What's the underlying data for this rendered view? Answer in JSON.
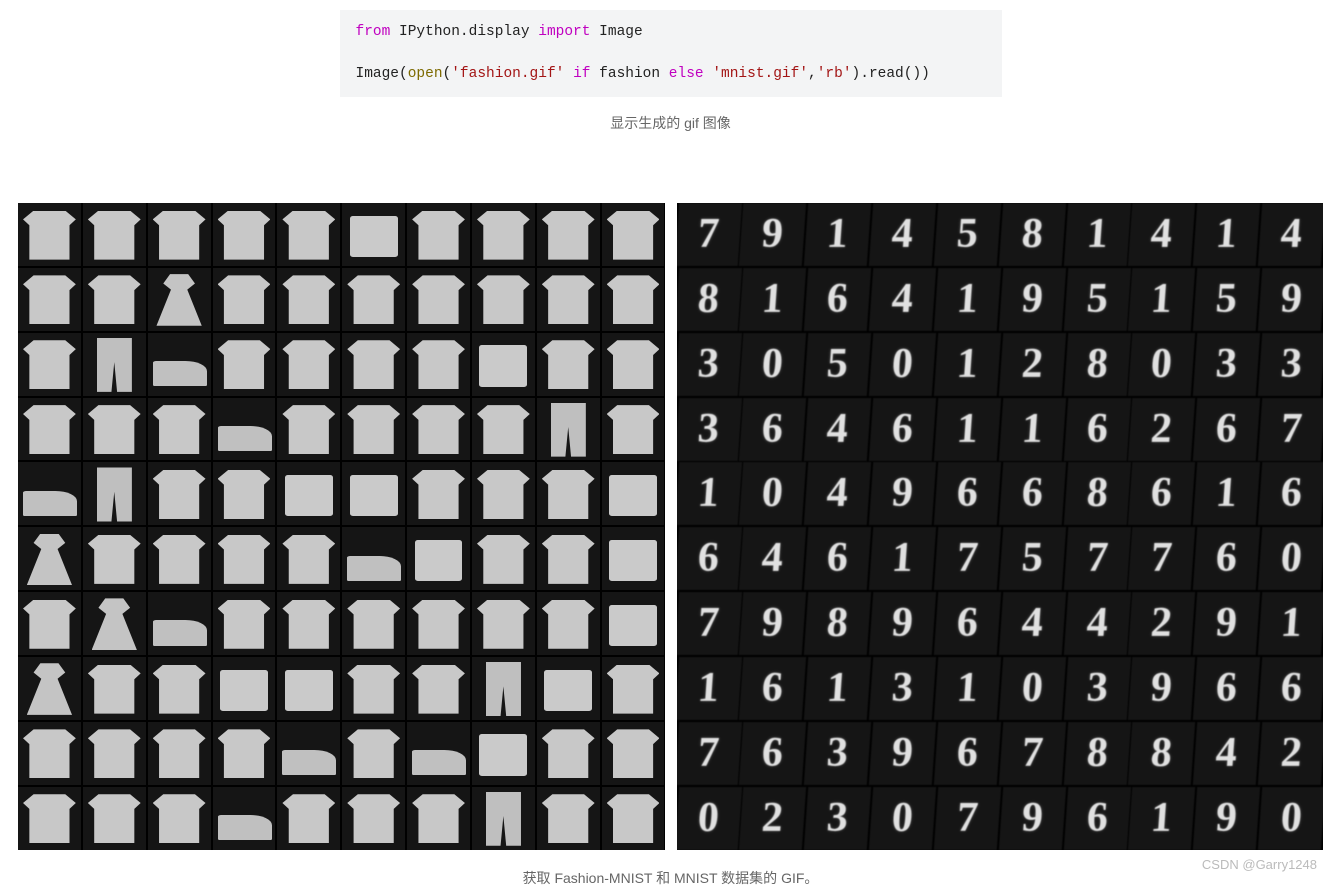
{
  "code": {
    "tokens": [
      {
        "t": "from",
        "cls": "kw-from"
      },
      {
        "t": " IPython.display "
      },
      {
        "t": "import",
        "cls": "kw-import"
      },
      {
        "t": " Image\n\nImage("
      },
      {
        "t": "open",
        "cls": "func"
      },
      {
        "t": "("
      },
      {
        "t": "'fashion.gif'",
        "cls": "str"
      },
      {
        "t": " "
      },
      {
        "t": "if",
        "cls": "kw-if"
      },
      {
        "t": " fashion "
      },
      {
        "t": "else",
        "cls": "kw-else"
      },
      {
        "t": " "
      },
      {
        "t": "'mnist.gif'",
        "cls": "str"
      },
      {
        "t": ","
      },
      {
        "t": "'rb'",
        "cls": "str"
      },
      {
        "t": ").read())"
      }
    ]
  },
  "caption1": "显示生成的 gif 图像",
  "caption2": "获取 Fashion-MNIST 和 MNIST 数据集的 GIF。",
  "watermark": "CSDN @Garry1248",
  "fashion_grid": {
    "rows": 10,
    "cols": 10,
    "note": "Generated Fashion-MNIST samples (clothing silhouettes)",
    "cells": [
      [
        "shirt",
        "shirt",
        "shirt",
        "shirt",
        "shirt",
        "bag",
        "shirt",
        "shirt",
        "shirt",
        "shirt"
      ],
      [
        "shirt",
        "shirt",
        "dress",
        "shirt",
        "shirt",
        "shirt",
        "shirt",
        "shirt",
        "shirt",
        "shirt"
      ],
      [
        "shirt",
        "pant",
        "shoe",
        "shirt",
        "shirt",
        "shirt",
        "shirt",
        "bag",
        "shirt",
        "shirt"
      ],
      [
        "shirt",
        "shirt",
        "shirt",
        "shoe",
        "shirt",
        "shirt",
        "shirt",
        "shirt",
        "pant",
        "shirt"
      ],
      [
        "shoe",
        "pant",
        "shirt",
        "shirt",
        "bag",
        "bag",
        "shirt",
        "shirt",
        "shirt",
        "bag"
      ],
      [
        "dress",
        "shirt",
        "shirt",
        "shirt",
        "shirt",
        "shoe",
        "bag",
        "shirt",
        "shirt",
        "bag"
      ],
      [
        "shirt",
        "dress",
        "shoe",
        "shirt",
        "shirt",
        "shirt",
        "shirt",
        "shirt",
        "shirt",
        "bag"
      ],
      [
        "dress",
        "shirt",
        "shirt",
        "bag",
        "bag",
        "shirt",
        "shirt",
        "pant",
        "bag",
        "shirt"
      ],
      [
        "shirt",
        "shirt",
        "shirt",
        "shirt",
        "shoe",
        "shirt",
        "shoe",
        "bag",
        "shirt",
        "shirt"
      ],
      [
        "shirt",
        "shirt",
        "shirt",
        "shoe",
        "shirt",
        "shirt",
        "shirt",
        "pant",
        "shirt",
        "shirt"
      ]
    ]
  },
  "mnist_grid": {
    "rows": 10,
    "cols": 10,
    "note": "Generated MNIST digit samples",
    "cells": [
      [
        "7",
        "9",
        "1",
        "4",
        "5",
        "8",
        "1",
        "4",
        "1",
        "4"
      ],
      [
        "8",
        "1",
        "6",
        "4",
        "1",
        "9",
        "5",
        "1",
        "5",
        "9"
      ],
      [
        "3",
        "0",
        "5",
        "0",
        "1",
        "2",
        "8",
        "0",
        "3",
        "3"
      ],
      [
        "3",
        "6",
        "4",
        "6",
        "1",
        "1",
        "6",
        "2",
        "6",
        "7"
      ],
      [
        "1",
        "0",
        "4",
        "9",
        "6",
        "6",
        "8",
        "6",
        "1",
        "6"
      ],
      [
        "6",
        "4",
        "6",
        "1",
        "7",
        "5",
        "7",
        "7",
        "6",
        "0"
      ],
      [
        "7",
        "9",
        "8",
        "9",
        "6",
        "4",
        "4",
        "2",
        "9",
        "1"
      ],
      [
        "1",
        "6",
        "1",
        "3",
        "1",
        "0",
        "3",
        "9",
        "6",
        "6"
      ],
      [
        "7",
        "6",
        "3",
        "9",
        "6",
        "7",
        "8",
        "8",
        "4",
        "2"
      ],
      [
        "0",
        "2",
        "3",
        "0",
        "7",
        "9",
        "6",
        "1",
        "9",
        "0"
      ]
    ]
  }
}
